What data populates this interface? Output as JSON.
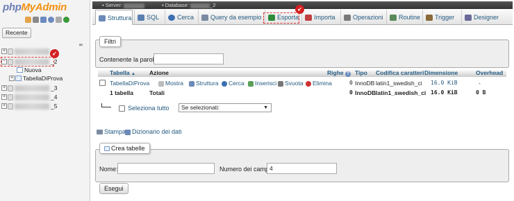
{
  "logo": {
    "php": "php",
    "my": "MyAdmin"
  },
  "left": {
    "recent_label": "Recente",
    "databases": [
      {
        "suffix": "_1",
        "expander": "+"
      },
      {
        "suffix": "_2",
        "expander": "−"
      },
      {
        "suffix": "_3",
        "expander": "+"
      },
      {
        "suffix": "_4",
        "expander": "+"
      },
      {
        "suffix": "_5",
        "expander": "+"
      }
    ],
    "children": [
      {
        "label": "Nuova"
      },
      {
        "label": "TabellaDiProva"
      }
    ],
    "marker": "↙"
  },
  "breadcrumb": {
    "server": "Server:",
    "database": "Database:",
    "db_suffix": "_2"
  },
  "tabs": [
    {
      "label": "Struttura",
      "active": true,
      "color": "#6c8ab8"
    },
    {
      "label": "SQL",
      "color": "#5a7fb0"
    },
    {
      "label": "Cerca",
      "color": "#3c6fb0"
    },
    {
      "label": "Query da esempio",
      "color": "#7a8aa0"
    },
    {
      "label": "Esporta",
      "color": "#2e8b3a"
    },
    {
      "label": "Importa",
      "color": "#c04040"
    },
    {
      "label": "Operazioni",
      "color": "#7a7a7a"
    },
    {
      "label": "Routine",
      "color": "#5a8a5a"
    },
    {
      "label": "Trigger",
      "color": "#8a6a3a"
    },
    {
      "label": "Designer",
      "color": "#6a6a9a"
    }
  ],
  "tab_marker": "↙",
  "filter": {
    "legend": "Filtri",
    "label": "Contenente la parola:",
    "value": ""
  },
  "table": {
    "headers": {
      "tabella": "Tabella",
      "sort_arrow": "▲",
      "azione": "Azione",
      "righe": "Righe",
      "help": "?",
      "tipo": "Tipo",
      "codifica": "Codifica caratteri",
      "dimensione": "Dimensione",
      "overhead": "Overhead"
    },
    "rows": [
      {
        "name": "TabellaDiProva",
        "actions": [
          "Mostra",
          "Struttura",
          "Cerca",
          "Inserisci",
          "Svuota",
          "Elimina"
        ],
        "righe": "0",
        "tipo": "InnoDB",
        "codifica": "latin1_swedish_ci",
        "dimensione": "16.0 KiB",
        "overhead": "-"
      }
    ],
    "total": {
      "name": "1 tabella",
      "label": "Totali",
      "righe": "0",
      "tipo": "InnoDB",
      "codifica": "latin1_swedish_ci",
      "dimensione": "16.0 KiB",
      "overhead": "0 B"
    },
    "select_all": "Seleziona tutto",
    "with_selected": "Se selezionati:"
  },
  "links": {
    "print": "Stampa",
    "dictionary": "Dizionario dei dati"
  },
  "create": {
    "legend": "Crea tabelle",
    "name_label": "Nome:",
    "name_value": "",
    "cols_label": "Numero dei campi:",
    "cols_value": "4",
    "submit": "Esegui"
  }
}
